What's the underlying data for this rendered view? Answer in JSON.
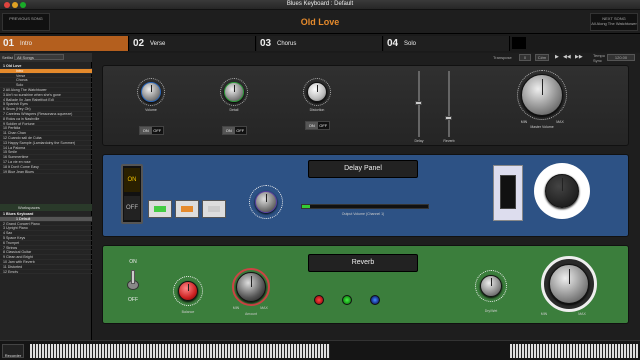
{
  "window": {
    "title": "Blues Keyboard : Default"
  },
  "header": {
    "prev_label": "PREVIOUS SONG",
    "song_title": "Old Love",
    "next_label": "NEXT SONG",
    "next_song": "All Along The Watchtower"
  },
  "parts": [
    {
      "num": "01",
      "label": "Intro"
    },
    {
      "num": "02",
      "label": "Verse"
    },
    {
      "num": "03",
      "label": "Chorus"
    },
    {
      "num": "04",
      "label": "Solo"
    }
  ],
  "setlist": {
    "label": "Setlist",
    "value": "All Songs"
  },
  "songs": [
    "1 Old Love",
    "Intro",
    "Verse",
    "Chorus",
    "Solo",
    "2 All Along The Watchtower",
    "3 Ain't no sunshine when she's gone",
    "4 Ballade (In Jam Rabelfoot Ed)",
    "5 Spanish Eyes",
    "6 Snow (Hey Oh)",
    "7 Careless Whispers (Ressonanz-squeeze)",
    "8 Rolos ca in Nashville",
    "9 Soldier of Fortune",
    "10 Perfidia",
    "11 Chan Chan",
    "12 Cuando sali de Cuba",
    "13 Happy Sample (Lamiardoiny the Summer)",
    "14 La Paloma",
    "15 Smile",
    "16 Summertime",
    "17 La vie en rose",
    "18 It Don't Come Easy",
    "19 Blue Jean Blues"
  ],
  "workspace": {
    "label": "Workspaces",
    "title": "1 Blues Keyboard",
    "items": [
      "1 Default",
      "2 Grand Concert Piano",
      "3 Upright Piano",
      "4 Sax",
      "5 Space Keys",
      "6 Trumpet",
      "7 Strings",
      "8 Classical Guitar",
      "9 Clean and Bright",
      "10 Jam with Reverb",
      "11 Distorted",
      "12 Empty"
    ]
  },
  "transport": {
    "transpose": "Transpose",
    "transpose_val": "0",
    "key": "C#m",
    "tempo": "120.00",
    "tempo_label": "Tempo",
    "sync": "Sync"
  },
  "top_panel": {
    "knob1": "Volume",
    "knob2": "Detail",
    "knob3": "Distortion",
    "slider1": "Delay",
    "slider2": "Reverb",
    "master": "Master Volume",
    "min": "MIN",
    "max": "MAX",
    "on": "ON",
    "off": "OFF"
  },
  "mid_panel": {
    "title": "Delay Panel",
    "meter_label": "Output Volume (Channel 1)",
    "on": "ON",
    "off": "OFF",
    "knob_scale": "10"
  },
  "bot_panel": {
    "title": "Reverb",
    "on": "ON",
    "off": "OFF",
    "knob1": "Balance",
    "knob2": "Amount",
    "knob3": "Dry/Wet",
    "min": "MIN",
    "max": "MAX"
  },
  "bottom": {
    "recorder": "Recorder"
  },
  "colors": {
    "accent": "#e58a2c",
    "blue_panel": "#2d5285",
    "green_panel": "#3b7e3c"
  }
}
